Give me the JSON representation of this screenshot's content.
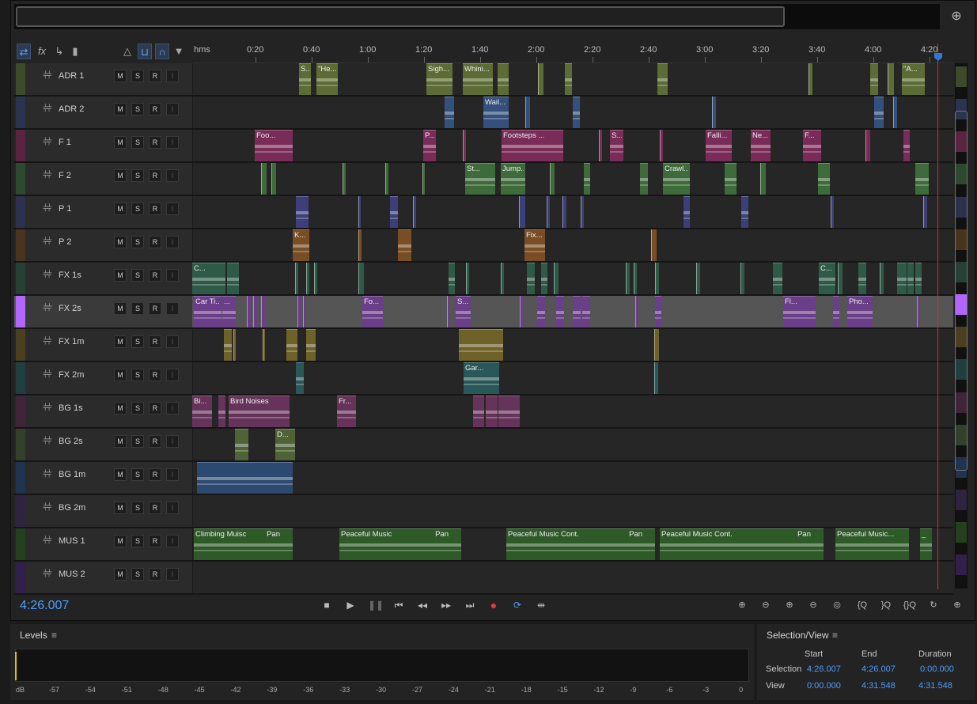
{
  "colors": {
    "accent": "#4a9eff",
    "playhead": "#c0392b",
    "selected_track": "#b266ff"
  },
  "ruler": {
    "unit": "hms",
    "labels": [
      "0:20",
      "0:40",
      "1:00",
      "1:20",
      "1:40",
      "2:00",
      "2:20",
      "2:40",
      "3:00",
      "3:20",
      "3:40",
      "4:00",
      "4:20"
    ]
  },
  "toolbar": {
    "icons": [
      "switch-icon",
      "fx-icon",
      "send-icon",
      "eq-icon",
      "metronome-icon",
      "snap-icon",
      "loop-icon",
      "marker-icon"
    ]
  },
  "buttons": {
    "mute": "M",
    "solo": "S",
    "record": "R",
    "input": "I"
  },
  "tracks": [
    {
      "name": "ADR 1",
      "color": "#3f4a2a",
      "clip_color": "#5d6b34",
      "clips": [
        {
          "label": "S...",
          "start": 0.14,
          "len": 0.016
        },
        {
          "label": "\"He...",
          "start": 0.163,
          "len": 0.028
        },
        {
          "label": "Sigh...",
          "start": 0.308,
          "len": 0.034
        },
        {
          "label": "Whini...",
          "start": 0.356,
          "len": 0.04
        },
        {
          "label": "",
          "start": 0.401,
          "len": 0.015
        },
        {
          "label": "",
          "start": 0.454,
          "len": 0.006
        },
        {
          "label": "",
          "start": 0.49,
          "len": 0.009
        },
        {
          "label": "",
          "start": 0.611,
          "len": 0.014
        },
        {
          "label": "",
          "start": 0.81,
          "len": 0.004
        },
        {
          "label": "",
          "start": 0.891,
          "len": 0.01
        },
        {
          "label": "",
          "start": 0.914,
          "len": 0.007
        },
        {
          "label": "\"A...",
          "start": 0.932,
          "len": 0.03
        }
      ]
    },
    {
      "name": "ADR 2",
      "color": "#2a3450",
      "clip_color": "#34507c",
      "clips": [
        {
          "label": "",
          "start": 0.332,
          "len": 0.012
        },
        {
          "label": "Wail...",
          "start": 0.383,
          "len": 0.033
        },
        {
          "label": "",
          "start": 0.438,
          "len": 0.005
        },
        {
          "label": "",
          "start": 0.5,
          "len": 0.009
        },
        {
          "label": "",
          "start": 0.683,
          "len": 0.004
        },
        {
          "label": "",
          "start": 0.896,
          "len": 0.012
        },
        {
          "label": "",
          "start": 0.921,
          "len": 0.004
        }
      ]
    },
    {
      "name": "F 1",
      "color": "#5a2440",
      "clip_color": "#7a2c58",
      "clips": [
        {
          "label": "Foo...",
          "start": 0.082,
          "len": 0.05
        },
        {
          "label": "P...",
          "start": 0.304,
          "len": 0.017
        },
        {
          "label": "",
          "start": 0.355,
          "len": 0.003
        },
        {
          "label": "Footsteps ...",
          "start": 0.406,
          "len": 0.081
        },
        {
          "label": "",
          "start": 0.534,
          "len": 0.003
        },
        {
          "label": "S...",
          "start": 0.549,
          "len": 0.018
        },
        {
          "label": "",
          "start": 0.614,
          "len": 0.003
        },
        {
          "label": "Falli...",
          "start": 0.675,
          "len": 0.034
        },
        {
          "label": "Ne...",
          "start": 0.734,
          "len": 0.026
        },
        {
          "label": "F...",
          "start": 0.803,
          "len": 0.024
        },
        {
          "label": "",
          "start": 0.885,
          "len": 0.005
        },
        {
          "label": "",
          "start": 0.935,
          "len": 0.008
        }
      ]
    },
    {
      "name": "F 2",
      "color": "#2e4a2e",
      "clip_color": "#3e6b3a",
      "clips": [
        {
          "label": "",
          "start": 0.09,
          "len": 0.006
        },
        {
          "label": "",
          "start": 0.104,
          "len": 0.005
        },
        {
          "label": "",
          "start": 0.197,
          "len": 0.003
        },
        {
          "label": "",
          "start": 0.254,
          "len": 0.003
        },
        {
          "label": "",
          "start": 0.303,
          "len": 0.002
        },
        {
          "label": "St...",
          "start": 0.359,
          "len": 0.04
        },
        {
          "label": "Jump...",
          "start": 0.405,
          "len": 0.032
        },
        {
          "label": "",
          "start": 0.47,
          "len": 0.005
        },
        {
          "label": "",
          "start": 0.515,
          "len": 0.008
        },
        {
          "label": "",
          "start": 0.588,
          "len": 0.01
        },
        {
          "label": "Crawl...",
          "start": 0.618,
          "len": 0.035
        },
        {
          "label": "",
          "start": 0.7,
          "len": 0.016
        },
        {
          "label": "",
          "start": 0.746,
          "len": 0.006
        },
        {
          "label": "",
          "start": 0.822,
          "len": 0.016
        },
        {
          "label": "",
          "start": 0.95,
          "len": 0.018
        }
      ]
    },
    {
      "name": "P 1",
      "color": "#2e3050",
      "clip_color": "#3c3f7a",
      "clips": [
        {
          "label": "",
          "start": 0.136,
          "len": 0.017
        },
        {
          "label": "",
          "start": 0.218,
          "len": 0.002
        },
        {
          "label": "",
          "start": 0.26,
          "len": 0.01
        },
        {
          "label": "",
          "start": 0.29,
          "len": 0.003
        },
        {
          "label": "",
          "start": 0.429,
          "len": 0.007
        },
        {
          "label": "",
          "start": 0.466,
          "len": 0.003
        },
        {
          "label": "",
          "start": 0.487,
          "len": 0.004
        },
        {
          "label": "",
          "start": 0.51,
          "len": 0.003
        },
        {
          "label": "",
          "start": 0.646,
          "len": 0.008
        },
        {
          "label": "",
          "start": 0.721,
          "len": 0.009
        },
        {
          "label": "",
          "start": 0.839,
          "len": 0.003
        },
        {
          "label": "",
          "start": 0.96,
          "len": 0.004
        }
      ]
    },
    {
      "name": "P 2",
      "color": "#4a3420",
      "clip_color": "#7a4e24",
      "clips": [
        {
          "label": "K...",
          "start": 0.132,
          "len": 0.022
        },
        {
          "label": "",
          "start": 0.218,
          "len": 0.003
        },
        {
          "label": "",
          "start": 0.27,
          "len": 0.018
        },
        {
          "label": "Fix...",
          "start": 0.437,
          "len": 0.027
        },
        {
          "label": "",
          "start": 0.603,
          "len": 0.006
        }
      ]
    },
    {
      "name": "FX 1s",
      "color": "#264035",
      "clip_color": "#2e5a48",
      "clips": [
        {
          "label": "C...",
          "start": 0.0,
          "len": 0.044
        },
        {
          "label": "",
          "start": 0.046,
          "len": 0.016
        },
        {
          "label": "",
          "start": 0.135,
          "len": 0.003
        },
        {
          "label": "",
          "start": 0.15,
          "len": 0.003
        },
        {
          "label": "",
          "start": 0.16,
          "len": 0.003
        },
        {
          "label": "",
          "start": 0.218,
          "len": 0.006
        },
        {
          "label": "",
          "start": 0.337,
          "len": 0.008
        },
        {
          "label": "",
          "start": 0.36,
          "len": 0.003
        },
        {
          "label": "",
          "start": 0.405,
          "len": 0.003
        },
        {
          "label": "",
          "start": 0.44,
          "len": 0.01
        },
        {
          "label": "",
          "start": 0.458,
          "len": 0.008
        },
        {
          "label": "",
          "start": 0.475,
          "len": 0.005
        },
        {
          "label": "",
          "start": 0.57,
          "len": 0.004
        },
        {
          "label": "",
          "start": 0.58,
          "len": 0.003
        },
        {
          "label": "",
          "start": 0.608,
          "len": 0.004
        },
        {
          "label": "",
          "start": 0.662,
          "len": 0.004
        },
        {
          "label": "",
          "start": 0.72,
          "len": 0.004
        },
        {
          "label": "",
          "start": 0.763,
          "len": 0.012
        },
        {
          "label": "C...",
          "start": 0.823,
          "len": 0.022
        },
        {
          "label": "",
          "start": 0.848,
          "len": 0.005
        },
        {
          "label": "",
          "start": 0.875,
          "len": 0.01
        },
        {
          "label": "",
          "start": 0.903,
          "len": 0.004
        },
        {
          "label": "",
          "start": 0.926,
          "len": 0.012
        },
        {
          "label": "",
          "start": 0.94,
          "len": 0.008
        },
        {
          "label": "",
          "start": 0.95,
          "len": 0.008
        }
      ]
    },
    {
      "name": "FX 2s",
      "color": "#b266ff",
      "clip_color": "#6a3e88",
      "selected": true,
      "clips": [
        {
          "label": "Car Ti...",
          "start": 0.002,
          "len": 0.036
        },
        {
          "label": "...",
          "start": 0.039,
          "len": 0.018
        },
        {
          "label": "",
          "start": 0.072,
          "len": 0.004
        },
        {
          "label": "",
          "start": 0.08,
          "len": 0.004
        },
        {
          "label": "",
          "start": 0.09,
          "len": 0.004
        },
        {
          "label": "",
          "start": 0.138,
          "len": 0.003
        },
        {
          "label": "",
          "start": 0.146,
          "len": 0.003
        },
        {
          "label": "Fo...",
          "start": 0.224,
          "len": 0.027
        },
        {
          "label": "",
          "start": 0.335,
          "len": 0.003
        },
        {
          "label": "S...",
          "start": 0.346,
          "len": 0.02
        },
        {
          "label": "",
          "start": 0.43,
          "len": 0.003
        },
        {
          "label": "",
          "start": 0.453,
          "len": 0.01
        },
        {
          "label": "",
          "start": 0.478,
          "len": 0.01
        },
        {
          "label": "",
          "start": 0.5,
          "len": 0.01
        },
        {
          "label": "",
          "start": 0.512,
          "len": 0.01
        },
        {
          "label": "",
          "start": 0.582,
          "len": 0.003
        },
        {
          "label": "",
          "start": 0.608,
          "len": 0.008
        },
        {
          "label": "Fl...",
          "start": 0.776,
          "len": 0.043
        },
        {
          "label": "",
          "start": 0.842,
          "len": 0.008
        },
        {
          "label": "Pho...",
          "start": 0.861,
          "len": 0.033
        },
        {
          "label": "",
          "start": 0.952,
          "len": 0.003
        }
      ]
    },
    {
      "name": "FX 1m",
      "color": "#4a4020",
      "clip_color": "#6e6228",
      "clips": [
        {
          "label": "",
          "start": 0.042,
          "len": 0.01
        },
        {
          "label": "",
          "start": 0.054,
          "len": 0.002
        },
        {
          "label": "",
          "start": 0.092,
          "len": 0.002
        },
        {
          "label": "",
          "start": 0.124,
          "len": 0.015
        },
        {
          "label": "",
          "start": 0.15,
          "len": 0.012
        },
        {
          "label": "",
          "start": 0.35,
          "len": 0.058
        },
        {
          "label": "",
          "start": 0.607,
          "len": 0.005
        }
      ]
    },
    {
      "name": "FX 2m",
      "color": "#204040",
      "clip_color": "#2a5858",
      "clips": [
        {
          "label": "",
          "start": 0.136,
          "len": 0.01
        },
        {
          "label": "Gar...",
          "start": 0.357,
          "len": 0.047
        },
        {
          "label": "",
          "start": 0.607,
          "len": 0.004
        }
      ]
    },
    {
      "name": "BG 1s",
      "color": "#40243a",
      "clip_color": "#66345a",
      "clips": [
        {
          "label": "Bi...",
          "start": 0.0,
          "len": 0.026
        },
        {
          "label": "",
          "start": 0.034,
          "len": 0.009
        },
        {
          "label": "Bird Noises",
          "start": 0.048,
          "len": 0.08
        },
        {
          "label": "Fr...",
          "start": 0.19,
          "len": 0.025
        },
        {
          "label": "",
          "start": 0.369,
          "len": 0.015
        },
        {
          "label": "",
          "start": 0.386,
          "len": 0.016
        },
        {
          "label": "",
          "start": 0.402,
          "len": 0.013
        },
        {
          "label": "",
          "start": 0.416,
          "len": 0.015
        }
      ]
    },
    {
      "name": "BG 2s",
      "color": "#34402a",
      "clip_color": "#4e6436",
      "clips": [
        {
          "label": "",
          "start": 0.056,
          "len": 0.018
        },
        {
          "label": "D...",
          "start": 0.109,
          "len": 0.026
        }
      ]
    },
    {
      "name": "BG 1m",
      "color": "#203450",
      "clip_color": "#2c4a70",
      "clips": [
        {
          "label": "",
          "start": 0.006,
          "len": 0.126
        }
      ]
    },
    {
      "name": "BG 2m",
      "color": "#2e2440",
      "clip_color": "#44385e",
      "clips": []
    },
    {
      "name": "MUS 1",
      "color": "#24401e",
      "clip_color": "#2e5a28",
      "clips": [
        {
          "label": "Climbing Muisc",
          "start": 0.002,
          "len": 0.13,
          "pan": "Pan"
        },
        {
          "label": "Peaceful Music",
          "start": 0.193,
          "len": 0.16,
          "pan": "Pan"
        },
        {
          "label": "Peaceful Music Cont.",
          "start": 0.413,
          "len": 0.195,
          "pan": "Pan"
        },
        {
          "label": "Peaceful Music Cont.",
          "start": 0.614,
          "len": 0.215,
          "pan": "Pan"
        },
        {
          "label": "Peaceful Music...",
          "start": 0.845,
          "len": 0.097,
          "pan": ""
        },
        {
          "label": "_",
          "start": 0.956,
          "len": 0.016,
          "pan": ""
        }
      ]
    },
    {
      "name": "MUS 2",
      "color": "#30204a",
      "clip_color": "#442e66",
      "clips": []
    }
  ],
  "transport": {
    "timecode": "4:26.007",
    "icons": [
      "stop-icon",
      "play-icon",
      "pause-icon",
      "skip-back-icon",
      "rewind-icon",
      "fast-forward-icon",
      "skip-forward-icon",
      "record-icon",
      "loop-icon",
      "skip-selection-icon"
    ]
  },
  "zoom": {
    "icons": [
      "zoom-in-amplitude-icon",
      "zoom-out-amplitude-icon",
      "zoom-in-time-icon",
      "zoom-out-time-icon",
      "zoom-full-icon",
      "zoom-in-left-icon",
      "zoom-in-right-icon",
      "zoom-selection-icon",
      "zoom-reset-icon",
      "zoom-track-icon"
    ]
  },
  "levels": {
    "title": "Levels",
    "scale": [
      "dB",
      "-57",
      "-54",
      "-51",
      "-48",
      "-45",
      "-42",
      "-39",
      "-36",
      "-33",
      "-30",
      "-27",
      "-24",
      "-21",
      "-18",
      "-15",
      "-12",
      "-9",
      "-6",
      "-3",
      "0"
    ]
  },
  "selection_view": {
    "title": "Selection/View",
    "headers": {
      "start": "Start",
      "end": "End",
      "duration": "Duration"
    },
    "selection": {
      "label": "Selection",
      "start": "4:26.007",
      "end": "4:26.007",
      "duration": "0:00.000"
    },
    "view": {
      "label": "View",
      "start": "0:00.000",
      "end": "4:31.548",
      "duration": "4:31.548"
    }
  }
}
